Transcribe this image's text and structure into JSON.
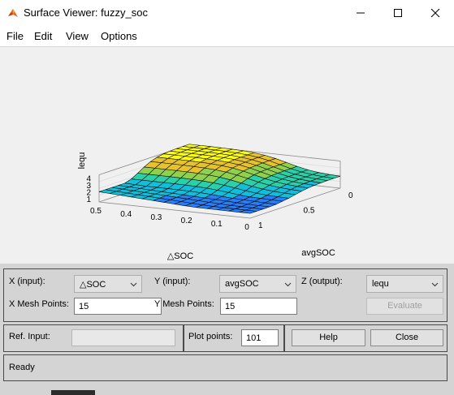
{
  "window": {
    "title": "Surface Viewer: fuzzy_soc"
  },
  "menu": {
    "items": [
      "File",
      "Edit",
      "View",
      "Options"
    ]
  },
  "plot": {
    "zlabel": "lequ",
    "xlabel": "△SOC",
    "ylabel": "avgSOC",
    "x_ticks": [
      "0.5",
      "0.4",
      "0.3",
      "0.2",
      "0.1",
      "0"
    ],
    "y_ticks": [
      "1",
      "0.5",
      "0"
    ],
    "z_ticks": [
      "1",
      "2",
      "3",
      "4"
    ],
    "colormap": [
      "#3e26a8",
      "#2a7ef5",
      "#13bedb",
      "#2bcfa8",
      "#8fd04e",
      "#e6c22e",
      "#f9fb15"
    ]
  },
  "chart_data": {
    "type": "surface",
    "xlabel": "△SOC",
    "ylabel": "avgSOC",
    "zlabel": "lequ",
    "xlim": [
      0,
      0.5
    ],
    "ylim": [
      0,
      1
    ],
    "zlim": [
      0.5,
      4.5
    ],
    "mesh": [
      15,
      15
    ],
    "note_levels": [
      0.5,
      1,
      2,
      3,
      3.5,
      4.6
    ]
  },
  "controls": {
    "x_input_label": "X (input):",
    "x_input_value": "△SOC",
    "y_input_label": "Y (input):",
    "y_input_value": "avgSOC",
    "z_output_label": "Z (output):",
    "z_output_value": "lequ",
    "x_mesh_label": "X Mesh Points:",
    "x_mesh_value": "15",
    "y_mesh_label": "Y Mesh Points:",
    "y_mesh_value": "15",
    "evaluate_label": "Evaluate",
    "ref_input_label": "Ref. Input:",
    "plot_points_label": "Plot points:",
    "plot_points_value": "101",
    "help_label": "Help",
    "close_label": "Close"
  },
  "status": {
    "text": "Ready"
  }
}
